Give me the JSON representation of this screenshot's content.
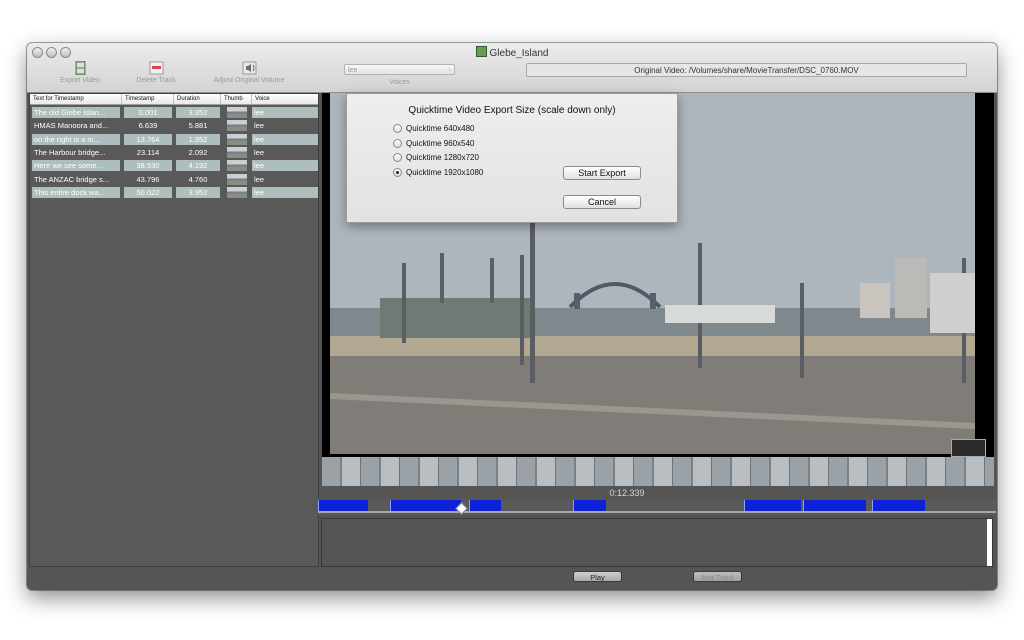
{
  "window": {
    "title": "Glebe_Island",
    "toolbar": {
      "export_video": "Export Video",
      "delete_track": "Delete Track",
      "adjust_volume": "Adjust Original Volume",
      "voices_value": "lee",
      "voices_label": "Voices"
    },
    "original_video": "Original Video: /Volumes/share/MovieTransfer/DSC_0760.MOV"
  },
  "table": {
    "headers": [
      "Text for Timestamp",
      "Timestamp",
      "Duration",
      "Thumb",
      "Voice"
    ],
    "rows": [
      {
        "text": "The old Glebe Islan...",
        "timestamp": "0.001",
        "duration": "3.852",
        "voice": "lee",
        "selected": true
      },
      {
        "text": "HMAS Manoora and...",
        "timestamp": "6.639",
        "duration": "5.881",
        "voice": "lee",
        "selected": false
      },
      {
        "text": "on the right is a m...",
        "timestamp": "13.764",
        "duration": "1.952",
        "voice": "lee",
        "selected": true
      },
      {
        "text": "The Harbour bridge...",
        "timestamp": "23.114",
        "duration": "2.092",
        "voice": "lee",
        "selected": false
      },
      {
        "text": "Here we see some...",
        "timestamp": "38.530",
        "duration": "4.192",
        "voice": "lee",
        "selected": true
      },
      {
        "text": "The ANZAC bridge s...",
        "timestamp": "43.796",
        "duration": "4.760",
        "voice": "lee",
        "selected": false
      },
      {
        "text": "This entire dock wa...",
        "timestamp": "50.022",
        "duration": "3.952",
        "voice": "lee",
        "selected": true
      }
    ]
  },
  "player": {
    "current_time": "0:12.339"
  },
  "bottom": {
    "play_label": "Play",
    "add_track_label": "Add Track"
  },
  "export_dialog": {
    "title": "Quicktime Video Export Size (scale down only)",
    "options": [
      "Quicktime 640x480",
      "Quicktime 960x540",
      "Quicktime 1280x720",
      "Quicktime 1920x1080"
    ],
    "selected_option": "Quicktime 1920x1080",
    "start_label": "Start Export",
    "cancel_label": "Cancel"
  },
  "colors": {
    "timeline_segment": "#0e20d8",
    "row_selected": "#aebdbd",
    "window_bg": "#555555"
  }
}
